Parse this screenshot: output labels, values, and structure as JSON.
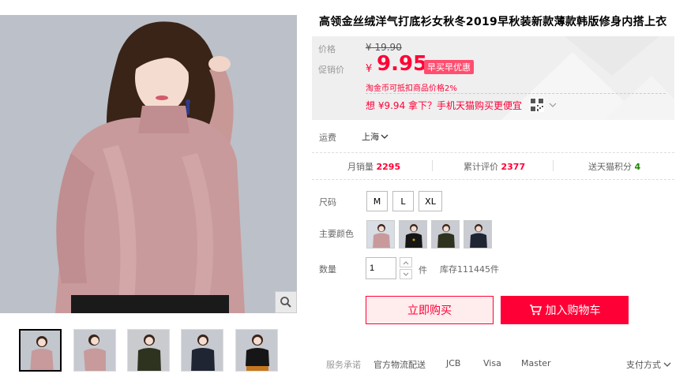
{
  "product": {
    "title": "高领金丝绒洋气打底衫女秋冬2019早秋装新款薄款韩版修身内搭上衣"
  },
  "price_panel": {
    "price_label": "价格",
    "original_currency": "¥",
    "original_price": "19.90",
    "promo_label": "促销价",
    "promo_currency": "¥",
    "promo_price": "9.95",
    "promo_badge": "早买早优惠",
    "coin_note": "淘金币可抵扣商品价格2%",
    "app_prefix": "想",
    "app_price": "¥9.94",
    "app_suffix": "拿下？手机天猫购买更便宜"
  },
  "shipping": {
    "label": "运费",
    "location": "上海"
  },
  "stats": {
    "monthly_sales_label": "月销量",
    "monthly_sales_value": "2295",
    "reviews_label": "累计评价",
    "reviews_value": "2377",
    "points_label": "送天猫积分",
    "points_value": "4"
  },
  "size": {
    "label": "尺码",
    "options": [
      "M",
      "L",
      "XL"
    ]
  },
  "color": {
    "label": "主要颜色",
    "swatches": [
      {
        "name": "pink",
        "top": "#c89a9c",
        "bg": "#d9dde4"
      },
      {
        "name": "black",
        "top": "#161616",
        "bg": "#c9ccd2"
      },
      {
        "name": "green",
        "top": "#2e3320",
        "bg": "#c9ccd2"
      },
      {
        "name": "navy",
        "top": "#1f2532",
        "bg": "#c9ccd2"
      }
    ]
  },
  "quantity": {
    "label": "数量",
    "value": "1",
    "unit": "件",
    "stock": "库存111445件"
  },
  "actions": {
    "buy_now": "立即购买",
    "add_to_cart": "加入购物车"
  },
  "services": {
    "label": "服务承诺",
    "items": [
      "官方物流配送",
      "JCB",
      "Visa",
      "Master"
    ],
    "payment_label": "支付方式"
  },
  "colors": {
    "accent": "#ff0036",
    "accent_soft": "#ffeded",
    "panel_bg": "#efefef"
  }
}
